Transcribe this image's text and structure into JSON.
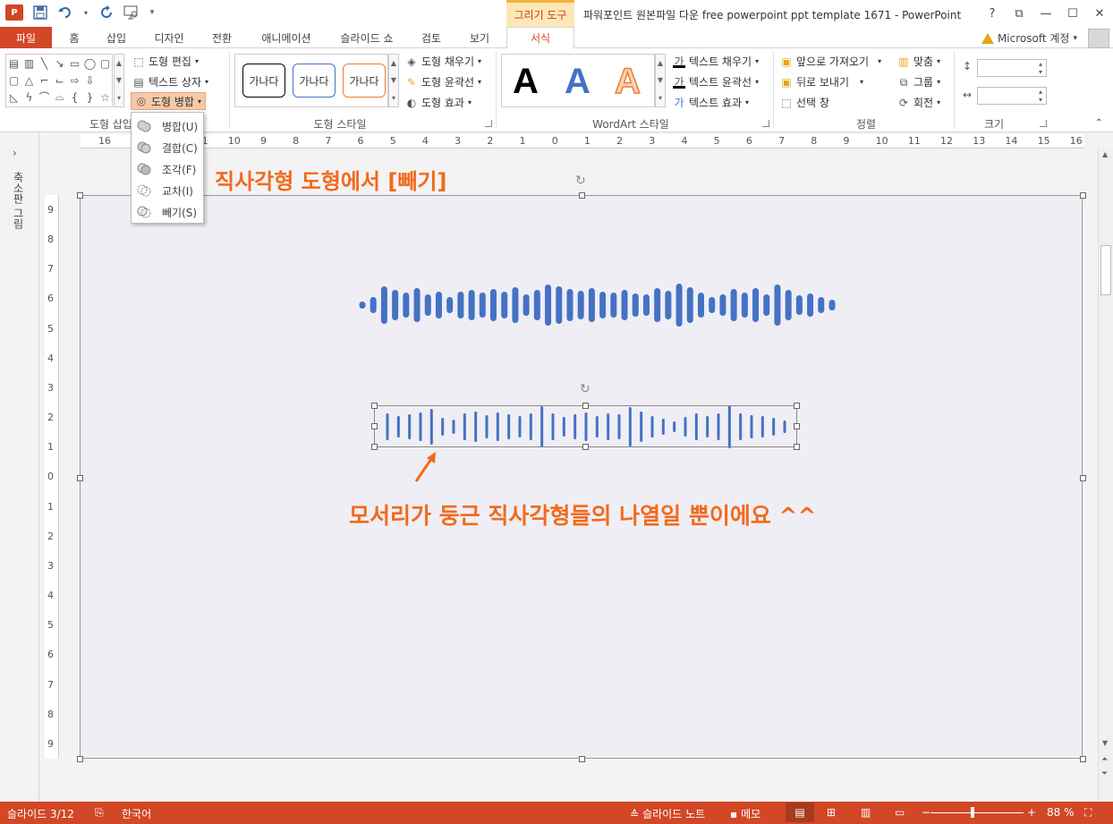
{
  "window": {
    "title": "파워포인트 원본파일 다운 free powerpoint ppt template 1671 - PowerPoint",
    "context_tab_group": "그리기 도구",
    "controls": [
      "?",
      "⧉",
      "—",
      "☐",
      "✕"
    ]
  },
  "tabs": [
    "파일",
    "홈",
    "삽입",
    "디자인",
    "전환",
    "애니메이션",
    "슬라이드 쇼",
    "검토",
    "보기",
    "서식"
  ],
  "active_tab": "서식",
  "account": "Microsoft 계정",
  "ribbon": {
    "insert_shapes": {
      "label": "도형 삽입",
      "edit_shape": "도형 편집",
      "text_box": "텍스트 상자",
      "merge_shapes": "도형 병합"
    },
    "shape_styles": {
      "label": "도형 스타일",
      "presets": [
        "가나다",
        "가나다",
        "가나다"
      ],
      "fill": "도형 채우기",
      "outline": "도형 윤곽선",
      "effects": "도형 효과"
    },
    "wordart": {
      "label": "WordArt 스타일",
      "letters": [
        "A",
        "A",
        "A"
      ],
      "text_fill": "텍스트 채우기",
      "text_outline": "텍스트 윤곽선",
      "text_effects": "텍스트 효과"
    },
    "arrange": {
      "label": "정렬",
      "bring_forward": "앞으로 가져오기",
      "send_backward": "뒤로 보내기",
      "selection_pane": "선택 창",
      "align": "맞춤",
      "group": "그룹",
      "rotate": "회전"
    },
    "size": {
      "label": "크기"
    }
  },
  "merge_menu": {
    "items": [
      "병합(U)",
      "결합(C)",
      "조각(F)",
      "교차(I)",
      "빼기(S)"
    ]
  },
  "left_panel": {
    "label": "축소판 그림"
  },
  "rulers": {
    "horizontal": [
      "16",
      "14",
      "12",
      "11",
      "10",
      "9",
      "8",
      "7",
      "6",
      "5",
      "4",
      "3",
      "2",
      "1",
      "0",
      "1",
      "2",
      "3",
      "4",
      "5",
      "6",
      "7",
      "8",
      "9",
      "10",
      "11",
      "12",
      "13",
      "14",
      "15",
      "16"
    ],
    "vertical": [
      "9",
      "8",
      "7",
      "6",
      "5",
      "4",
      "3",
      "2",
      "1",
      "0",
      "1",
      "2",
      "3",
      "4",
      "5",
      "6",
      "7",
      "8",
      "9"
    ]
  },
  "slide": {
    "heading": "직사각형 도형에서 [빼기]",
    "caption": "모서리가 둥근 직사각형들의 나열일 뿐이에요 ^^",
    "waveform_top": [
      8,
      18,
      42,
      34,
      28,
      38,
      24,
      30,
      18,
      30,
      34,
      28,
      36,
      30,
      40,
      24,
      34,
      46,
      42,
      36,
      32,
      38,
      30,
      28,
      34,
      26,
      24,
      38,
      32,
      48,
      40,
      28,
      18,
      24,
      36,
      28,
      38,
      24,
      46,
      34,
      22,
      26,
      18,
      12
    ],
    "waveform_bottom": [
      30,
      24,
      28,
      32,
      40,
      20,
      16,
      30,
      34,
      26,
      32,
      28,
      24,
      30,
      46,
      30,
      22,
      28,
      32,
      24,
      30,
      28,
      44,
      34,
      24,
      18,
      12,
      22,
      30,
      24,
      30,
      48,
      30,
      26,
      24,
      20,
      14
    ],
    "accent_color": "#f26a1b",
    "bar_color": "#4472c4"
  },
  "status": {
    "slide_indicator": "슬라이드 3/12",
    "language": "한국어",
    "notes": "슬라이드 노트",
    "comments": "메모",
    "zoom": "88 %"
  },
  "colors": {
    "brand": "#d24726"
  }
}
